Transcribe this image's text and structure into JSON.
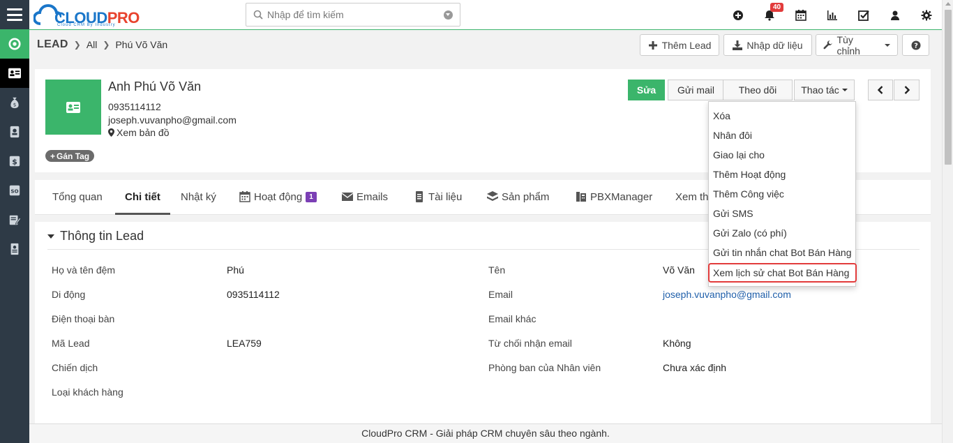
{
  "header": {
    "logo_main_a": "CLOUD",
    "logo_main_b": "PRO",
    "logo_sub": "Cloud CRM By Industry",
    "search_placeholder": "Nhập để tìm kiếm",
    "notification_count": "40",
    "icons": [
      "plus-circle-icon",
      "bell-icon",
      "calendar-icon",
      "bar-chart-icon",
      "checkbox-icon",
      "user-icon",
      "gear-icon"
    ]
  },
  "sidebar": {
    "icons": [
      "hamburger-icon",
      "target-icon",
      "lead-card-icon",
      "money-bag-icon",
      "contact-icon",
      "dollar-icon",
      "quote-icon",
      "edit-icon",
      "invoice-icon"
    ]
  },
  "breadcrumb": {
    "module": "LEAD",
    "filter": "All",
    "record": "Phú Võ Văn"
  },
  "toolbar": {
    "add_lead": "Thêm Lead",
    "import": "Nhập dữ liệu",
    "customize": "Tùy chỉnh",
    "help": "?"
  },
  "record": {
    "name": "Anh Phú Võ Văn",
    "phone": "0935114112",
    "email": "joseph.vuvanpho@gmail.com",
    "map_link": "Xem bản đồ",
    "tag_button": "Gán Tag"
  },
  "actions": {
    "edit": "Sửa",
    "send_mail": "Gửi mail",
    "follow": "Theo dõi",
    "more": "Thao tác"
  },
  "tabs": [
    {
      "label": "Tổng quan"
    },
    {
      "label": "Chi tiết"
    },
    {
      "label": "Nhật ký"
    },
    {
      "label": "Hoạt động",
      "count": "1"
    },
    {
      "label": "Emails"
    },
    {
      "label": "Tài liệu"
    },
    {
      "label": "Sản phẩm"
    },
    {
      "label": "PBXManager"
    },
    {
      "label": "Xem th"
    }
  ],
  "section": {
    "title": "Thông tin Lead",
    "fields_left": [
      {
        "label": "Họ và tên đệm",
        "value": "Phú"
      },
      {
        "label": "Di động",
        "value": "0935114112"
      },
      {
        "label": "Điện thoại bàn",
        "value": ""
      },
      {
        "label": "Mã Lead",
        "value": "LEA759"
      },
      {
        "label": "Chiến dịch",
        "value": ""
      },
      {
        "label": "Loại khách hàng",
        "value": ""
      }
    ],
    "fields_right": [
      {
        "label": "Tên",
        "value": "Võ Văn"
      },
      {
        "label": "Email",
        "value": "joseph.vuvanpho@gmail.com"
      },
      {
        "label": "Email khác",
        "value": ""
      },
      {
        "label": "Từ chối nhận email",
        "value": "Không"
      },
      {
        "label": "Phòng ban của Nhân viên",
        "value": "Chưa xác định"
      }
    ]
  },
  "dropdown": {
    "items": [
      "Xóa",
      "Nhân đôi",
      "Giao lại cho",
      "Thêm Hoạt động",
      "Thêm Công việc",
      "Gửi SMS",
      "Gửi Zalo (có phí)",
      "Gửi tin nhắn chat Bot Bán Hàng",
      "Xem lịch sử chat Bot Bán Hàng"
    ]
  },
  "footer": {
    "text": "CloudPro CRM - Giải pháp CRM chuyên sâu theo ngành."
  },
  "colors": {
    "brand_green": "#3bb56b",
    "sidebar_bg": "#2e3a46",
    "badge_red": "#e23b3b",
    "link_blue": "#1f5faa",
    "activity_count_purple": "#7b3fb5"
  }
}
